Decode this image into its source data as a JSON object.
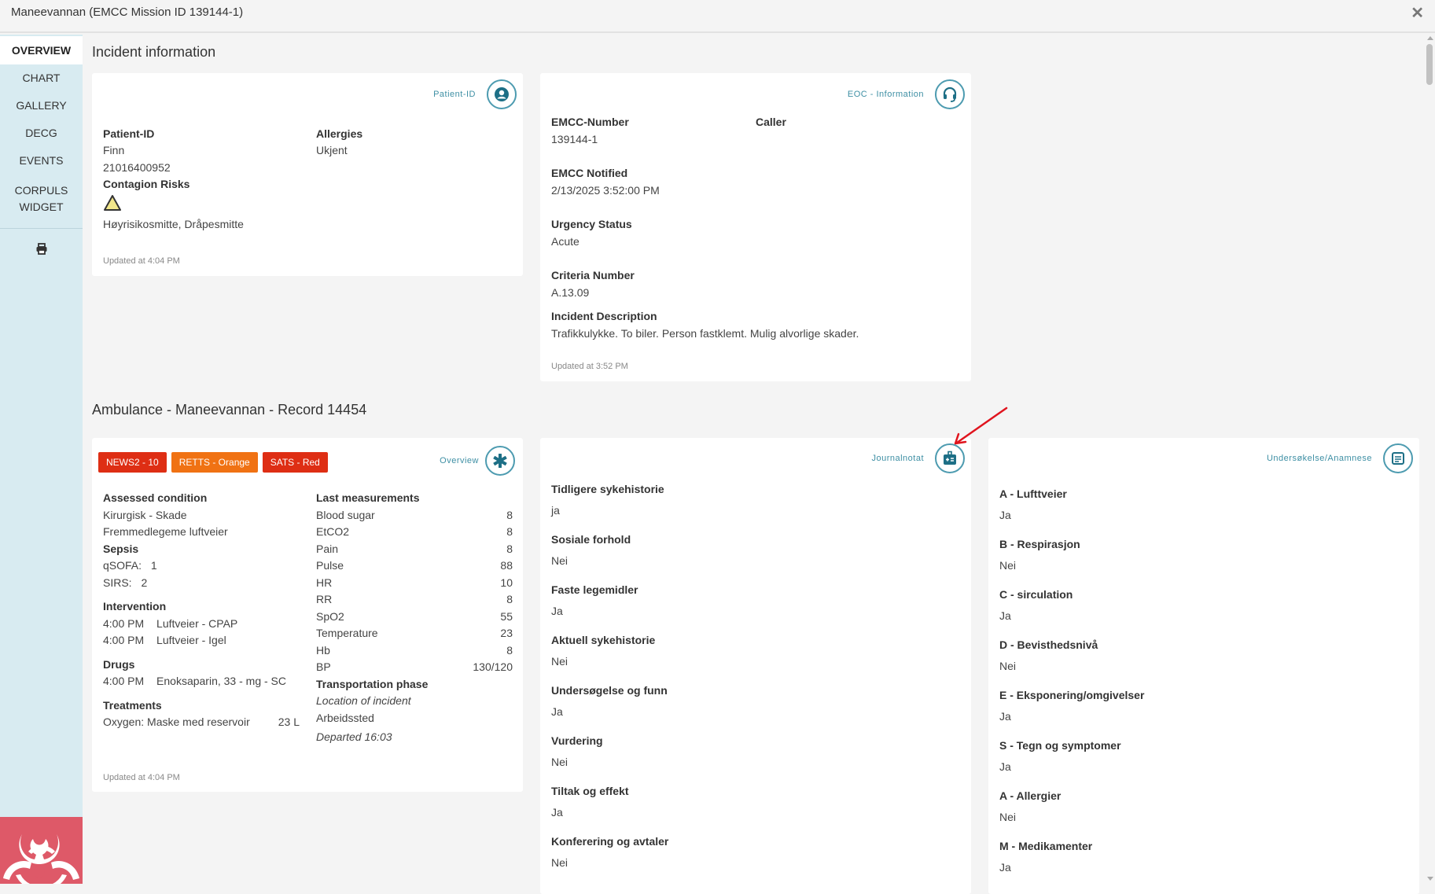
{
  "window": {
    "title": "Maneevannan (EMCC Mission ID 139144-1)",
    "close_icon": "close-icon"
  },
  "sidebar": {
    "items": [
      {
        "label": "OVERVIEW",
        "active": true
      },
      {
        "label": "CHART"
      },
      {
        "label": "GALLERY"
      },
      {
        "label": "DECG"
      },
      {
        "label": "EVENTS"
      },
      {
        "label": "CORPULS WIDGET"
      }
    ],
    "print_icon": "printer-icon",
    "alert_icon": "biohazard-icon",
    "alert_color": "#de5968"
  },
  "incident": {
    "section_title": "Incident information",
    "patient_card": {
      "header_label": "Patient-ID",
      "header_icon": "user-circle-icon",
      "patient_id_label": "Patient-ID",
      "name": "Finn",
      "id_number": "21016400952",
      "contagion_label": "Contagion Risks",
      "contagion_icon": "warning-triangle-icon",
      "contagion_value": "Høyrisikosmitte, Dråpesmitte",
      "allergies_label": "Allergies",
      "allergies_value": "Ukjent",
      "updated": "Updated at 4:04 PM"
    },
    "eoc_card": {
      "header_label": "EOC - Information",
      "header_icon": "headset-icon",
      "emcc_number_label": "EMCC-Number",
      "emcc_number": "139144-1",
      "caller_label": "Caller",
      "caller_value": "",
      "notified_label": "EMCC Notified",
      "notified_value": "2/13/2025 3:52:00 PM",
      "urgency_label": "Urgency Status",
      "urgency_value": "Acute",
      "criteria_label": "Criteria Number",
      "criteria_value": "A.13.09",
      "description_label": "Incident Description",
      "description_value": "Trafikkulykke. To biler. Person fastklemt. Mulig alvorlige skader.",
      "updated": "Updated at 3:52 PM"
    }
  },
  "ambulance": {
    "section_title": "Ambulance - Maneevannan - Record 14454",
    "overview_card": {
      "header_label": "Overview",
      "header_icon": "star-of-life-icon",
      "badges": [
        {
          "label": "NEWS2 - 10",
          "color": "#de2e14"
        },
        {
          "label": "RETTS - Orange",
          "color": "#f07213"
        },
        {
          "label": "SATS - Red",
          "color": "#de2e14"
        }
      ],
      "assessed_label": "Assessed condition",
      "assessed_values": [
        "Kirurgisk - Skade",
        "Fremmedlegeme luftveier"
      ],
      "sepsis_label": "Sepsis",
      "qsofa_label": "qSOFA:",
      "qsofa_value": "1",
      "sirs_label": "SIRS:",
      "sirs_value": "2",
      "intervention_label": "Intervention",
      "interventions": [
        {
          "time": "4:00 PM",
          "text": "Luftveier - CPAP"
        },
        {
          "time": "4:00 PM",
          "text": "Luftveier - Igel"
        }
      ],
      "drugs_label": "Drugs",
      "drugs": [
        {
          "time": "4:00 PM",
          "text": "Enoksaparin, 33 - mg - SC"
        }
      ],
      "treatments_label": "Treatments",
      "treatments": [
        {
          "text": "Oxygen: Maske med reservoir",
          "amount": "23 L"
        }
      ],
      "measurements_label": "Last measurements",
      "measurements": [
        {
          "name": "Blood sugar",
          "value": "8"
        },
        {
          "name": "EtCO2",
          "value": "8"
        },
        {
          "name": "Pain",
          "value": "8"
        },
        {
          "name": "Pulse",
          "value": "88"
        },
        {
          "name": "HR",
          "value": "10"
        },
        {
          "name": "RR",
          "value": "8"
        },
        {
          "name": "SpO2",
          "value": "55"
        },
        {
          "name": "Temperature",
          "value": "23"
        },
        {
          "name": "Hb",
          "value": "8"
        },
        {
          "name": "BP",
          "value": "130/120"
        }
      ],
      "transport_label": "Transportation phase",
      "transport_location_label": "Location of incident",
      "transport_location_value": "Arbeidssted",
      "transport_departed": "Departed 16:03",
      "updated": "Updated at 4:04 PM"
    },
    "journal_card": {
      "header_label": "Journalnotat",
      "header_icon": "medical-bag-icon",
      "items": [
        {
          "label": "Tidligere sykehistorie",
          "value": "ja"
        },
        {
          "label": "Sosiale forhold",
          "value": "Nei"
        },
        {
          "label": "Faste legemidler",
          "value": "Ja"
        },
        {
          "label": "Aktuell sykehistorie",
          "value": "Nei"
        },
        {
          "label": "Undersøgelse og funn",
          "value": "Ja"
        },
        {
          "label": "Vurdering",
          "value": "Nei"
        },
        {
          "label": "Tiltak og effekt",
          "value": "Ja"
        },
        {
          "label": "Konferering og avtaler",
          "value": "Nei"
        }
      ]
    },
    "exam_card": {
      "header_label": "Undersøkelse/Anamnese",
      "header_icon": "document-icon",
      "items": [
        {
          "label": "A - Lufttveier",
          "value": "Ja"
        },
        {
          "label": "B - Respirasjon",
          "value": "Nei"
        },
        {
          "label": "C - sirculation",
          "value": "Ja"
        },
        {
          "label": "D - Bevisthedsnivå",
          "value": "Nei"
        },
        {
          "label": "E - Eksponering/omgivelser",
          "value": "Ja"
        },
        {
          "label": "S - Tegn og symptomer",
          "value": "Ja"
        },
        {
          "label": "A - Allergier",
          "value": "Nei"
        },
        {
          "label": "M - Medikamenter",
          "value": "Ja"
        }
      ]
    }
  },
  "annotation": {
    "arrow_color": "#e0141e",
    "arrow_target": "journal-button"
  }
}
